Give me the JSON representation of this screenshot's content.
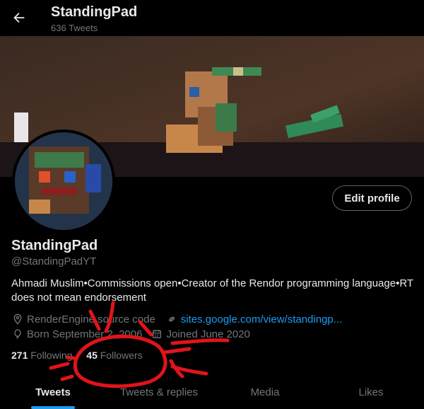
{
  "header": {
    "title": "StandingPad",
    "tweet_count": "636 Tweets"
  },
  "profile": {
    "display_name": "StandingPad",
    "handle": "@StandingPadYT",
    "bio": "Ahmadi Muslim•Commissions open•Creator of the Rendor programming language•RT does not mean endorsement",
    "edit_label": "Edit profile",
    "location": "RenderEngine source code",
    "website": "sites.google.com/view/standingp...",
    "birthday": "Born September 2, 2006",
    "joined": "Joined June 2020",
    "following_count": "271",
    "following_label": "Following",
    "followers_count": "45",
    "followers_label": "Followers"
  },
  "tabs": [
    {
      "label": "Tweets",
      "active": true
    },
    {
      "label": "Tweets & replies",
      "active": false
    },
    {
      "label": "Media",
      "active": false
    },
    {
      "label": "Likes",
      "active": false
    }
  ],
  "icons": [
    "back-arrow-icon",
    "location-icon",
    "link-icon",
    "balloon-icon",
    "calendar-icon"
  ],
  "colors": {
    "accent": "#1d9bf0",
    "annotation": "#e0141a",
    "muted": "#71767b"
  }
}
